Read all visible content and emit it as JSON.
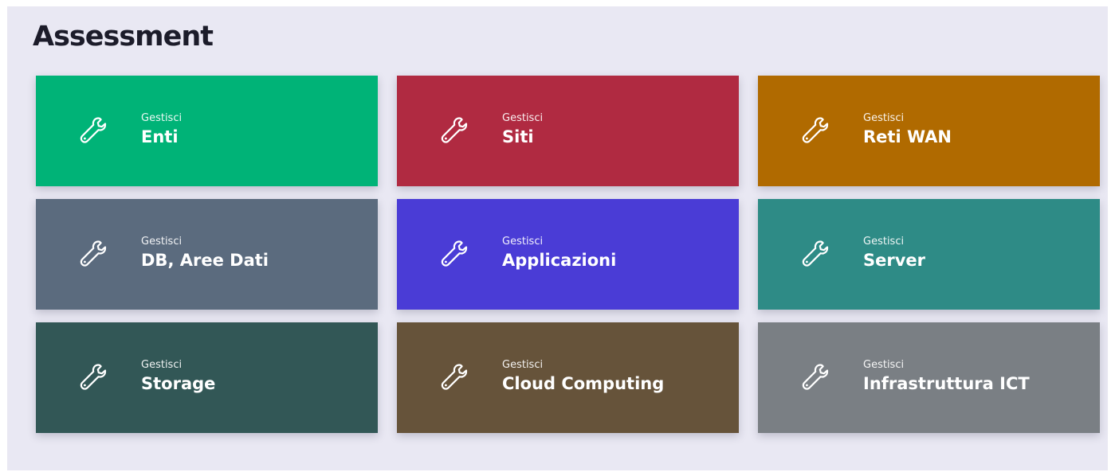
{
  "page": {
    "title": "Assessment"
  },
  "tiles": [
    {
      "kicker": "Gestisci",
      "label": "Enti",
      "color": "#00b377",
      "icon": "wrench-icon"
    },
    {
      "kicker": "Gestisci",
      "label": "Siti",
      "color": "#b02a41",
      "icon": "wrench-icon"
    },
    {
      "kicker": "Gestisci",
      "label": "Reti WAN",
      "color": "#b06a00",
      "icon": "wrench-icon"
    },
    {
      "kicker": "Gestisci",
      "label": "DB, Aree Dati",
      "color": "#5b6b7e",
      "icon": "wrench-icon"
    },
    {
      "kicker": "Gestisci",
      "label": "Applicazioni",
      "color": "#4a3cd6",
      "icon": "wrench-icon"
    },
    {
      "kicker": "Gestisci",
      "label": "Server",
      "color": "#2e8b86",
      "icon": "wrench-icon"
    },
    {
      "kicker": "Gestisci",
      "label": "Storage",
      "color": "#325756",
      "icon": "wrench-icon"
    },
    {
      "kicker": "Gestisci",
      "label": "Cloud Computing",
      "color": "#66533a",
      "icon": "wrench-icon"
    },
    {
      "kicker": "Gestisci",
      "label": "Infrastruttura ICT",
      "color": "#7a7f84",
      "icon": "wrench-icon"
    }
  ]
}
